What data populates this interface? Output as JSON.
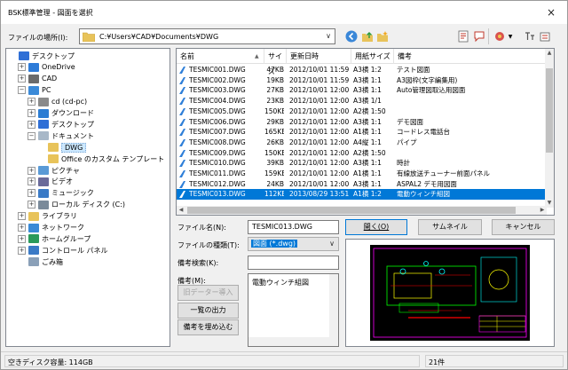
{
  "window": {
    "title": "BSK標準管理 - 図面を選択",
    "close": "×"
  },
  "location": {
    "label": "ファイルの場所(I):",
    "path": "C:¥Users¥CAD¥Documents¥DWG"
  },
  "tree": [
    {
      "label": "デスクトップ",
      "indent": 0,
      "exp": "",
      "icon": "#2f6fd6",
      "name": "tree-item-desktop-root"
    },
    {
      "label": "OneDrive",
      "indent": 1,
      "exp": "+",
      "icon": "#2d7bd8",
      "name": "tree-item-onedrive"
    },
    {
      "label": "CAD",
      "indent": 1,
      "exp": "+",
      "icon": "#6b6b6b",
      "name": "tree-item-cad"
    },
    {
      "label": "PC",
      "indent": 1,
      "exp": "−",
      "icon": "#3b8ad8",
      "name": "tree-item-pc"
    },
    {
      "label": "cd (cd-pc)",
      "indent": 2,
      "exp": "+",
      "icon": "#8a8a8a",
      "name": "tree-item-cd"
    },
    {
      "label": "ダウンロード",
      "indent": 2,
      "exp": "+",
      "icon": "#2b7cd3",
      "name": "tree-item-downloads"
    },
    {
      "label": "デスクトップ",
      "indent": 2,
      "exp": "+",
      "icon": "#2f6fd6",
      "name": "tree-item-desktop"
    },
    {
      "label": "ドキュメント",
      "indent": 2,
      "exp": "−",
      "icon": "#a8b8c8",
      "name": "tree-item-documents"
    },
    {
      "label": "DWG",
      "indent": 3,
      "exp": "",
      "icon": "#e8c35a",
      "name": "tree-item-dwg",
      "sel": true
    },
    {
      "label": "Office のカスタム テンプレート",
      "indent": 3,
      "exp": "",
      "icon": "#e8c35a",
      "name": "tree-item-office-templates"
    },
    {
      "label": "ピクチャ",
      "indent": 2,
      "exp": "+",
      "icon": "#5a9ad6",
      "name": "tree-item-pictures"
    },
    {
      "label": "ビデオ",
      "indent": 2,
      "exp": "+",
      "icon": "#6a6a9a",
      "name": "tree-item-videos"
    },
    {
      "label": "ミュージック",
      "indent": 2,
      "exp": "+",
      "icon": "#3a7ac6",
      "name": "tree-item-music"
    },
    {
      "label": "ローカル ディスク (C:)",
      "indent": 2,
      "exp": "+",
      "icon": "#7a8a9a",
      "name": "tree-item-local-disk"
    },
    {
      "label": "ライブラリ",
      "indent": 1,
      "exp": "+",
      "icon": "#e8c35a",
      "name": "tree-item-libraries"
    },
    {
      "label": "ネットワーク",
      "indent": 1,
      "exp": "+",
      "icon": "#3a8ad6",
      "name": "tree-item-network"
    },
    {
      "label": "ホームグループ",
      "indent": 1,
      "exp": "+",
      "icon": "#2a9a5a",
      "name": "tree-item-homegroup"
    },
    {
      "label": "コントロール パネル",
      "indent": 1,
      "exp": "+",
      "icon": "#3a7ac6",
      "name": "tree-item-control-panel"
    },
    {
      "label": "ごみ箱",
      "indent": 1,
      "exp": "",
      "icon": "#8aa0b8",
      "name": "tree-item-recycle-bin"
    }
  ],
  "list": {
    "headers": [
      "名前",
      "サイズ",
      "更新日時",
      "用紙サイズ",
      "備考"
    ],
    "sort_arrow": "▲",
    "rows": [
      [
        "TESMIC001.DWG",
        "47KB",
        "2012/10/01 11:59",
        "A3横 1:2",
        "テスト図面"
      ],
      [
        "TESMIC002.DWG",
        "19KB",
        "2012/10/01 11:59",
        "A3横 1:1",
        "A3図枠(文字編集用)"
      ],
      [
        "TESMIC003.DWG",
        "27KB",
        "2012/10/01 12:00",
        "A3横 1:1",
        "Auto管理図取込用図面"
      ],
      [
        "TESMIC004.DWG",
        "23KB",
        "2012/10/01 12:00",
        "A3横 1/1",
        ""
      ],
      [
        "TESMIC005.DWG",
        "150KB",
        "2012/10/01 12:00",
        "A2横 1:50",
        ""
      ],
      [
        "TESMIC006.DWG",
        "29KB",
        "2012/10/01 12:00",
        "A3横 1:1",
        "デモ図面"
      ],
      [
        "TESMIC007.DWG",
        "165KB",
        "2012/10/01 12:00",
        "A1横 1:1",
        "コードレス電話台"
      ],
      [
        "TESMIC008.DWG",
        "26KB",
        "2012/10/01 12:00",
        "A4縦 1:1",
        "パイプ"
      ],
      [
        "TESMIC009.DWG",
        "150KB",
        "2012/10/01 12:00",
        "A2横 1:50",
        ""
      ],
      [
        "TESMIC010.DWG",
        "39KB",
        "2012/10/01 12:00",
        "A3横 1:1",
        "時計"
      ],
      [
        "TESMIC011.DWG",
        "159KB",
        "2012/10/01 12:00",
        "A1横 1:1",
        "有線放送チューナー前面パネル"
      ],
      [
        "TESMIC012.DWG",
        "24KB",
        "2012/10/01 12:00",
        "A3横 1:1",
        "ASPAL2 デモ用図面"
      ],
      [
        "TESMIC013.DWG",
        "112KB",
        "2013/08/29 13:51",
        "A1横 1:2",
        "電動ウィンチ組図"
      ],
      [
        "",
        "",
        "",
        "",
        "..."
      ]
    ],
    "selected_index": 12
  },
  "form": {
    "filename_label": "ファイル名(N):",
    "filename_value": "TESMIC013.DWG",
    "filetype_label": "ファイルの種類(T):",
    "filetype_value": "図面 (*.dwg)",
    "search_label": "備考検索(K):",
    "memo_label": "備考(M):",
    "memo_value": "電動ウィンチ組図",
    "btn_import_old": "旧データー導入",
    "btn_list_output": "一覧の出力",
    "btn_embed_memo": "備考を埋め込む",
    "btn_open": "開く(O)",
    "btn_thumbnail": "サムネイル",
    "btn_cancel": "キャンセル"
  },
  "status": {
    "disk": "空きディスク容量: 114GB",
    "count": "21件"
  },
  "colors": {
    "accent": "#0078d7",
    "preview_bg": "#000000"
  }
}
